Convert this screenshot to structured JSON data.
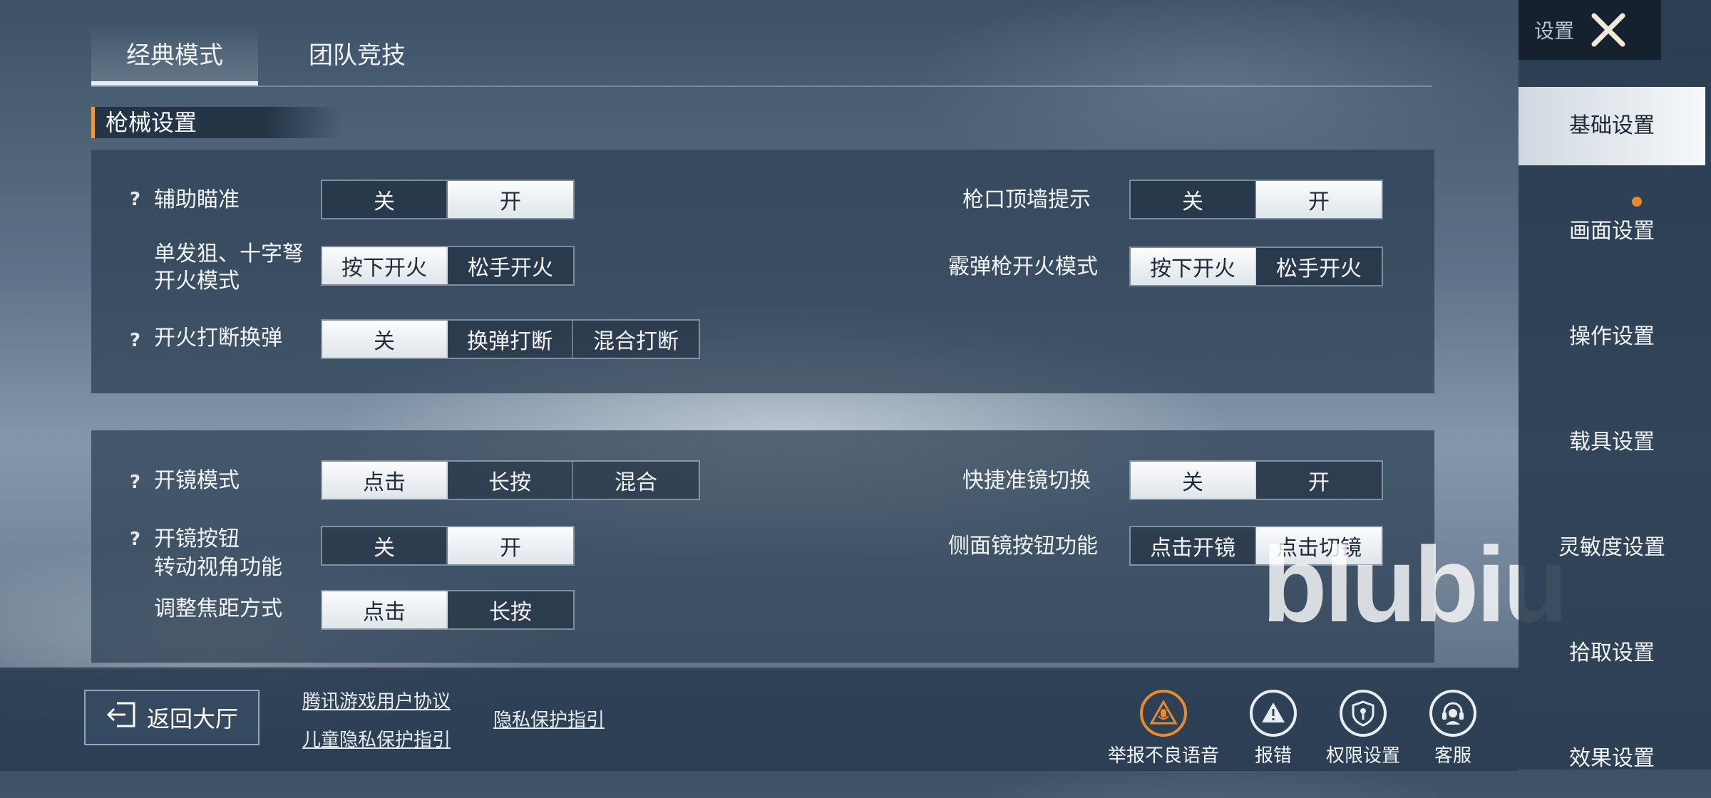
{
  "tabs": [
    {
      "label": "经典模式",
      "active": true
    },
    {
      "label": "团队竞技",
      "active": false
    }
  ],
  "section": {
    "title": "枪械设置"
  },
  "panel1": {
    "aim_assist": {
      "label": "辅助瞄准",
      "help": "?",
      "options": [
        "关",
        "开"
      ],
      "selected": "开"
    },
    "sniper_fire": {
      "label_line1": "单发狙、十字弩",
      "label_line2": "开火模式",
      "options": [
        "按下开火",
        "松手开火"
      ],
      "selected": "按下开火"
    },
    "fire_interrupt": {
      "label": "开火打断换弹",
      "help": "?",
      "options": [
        "关",
        "换弹打断",
        "混合打断"
      ],
      "selected": "关"
    },
    "muzzle_wall": {
      "label": "枪口顶墙提示",
      "options": [
        "关",
        "开"
      ],
      "selected": "开"
    },
    "shotgun_fire": {
      "label": "霰弹枪开火模式",
      "options": [
        "按下开火",
        "松手开火"
      ],
      "selected": "按下开火"
    }
  },
  "panel2": {
    "scope_mode": {
      "label": "开镜模式",
      "help": "?",
      "options": [
        "点击",
        "长按",
        "混合"
      ],
      "selected": "点击"
    },
    "scope_button": {
      "label_line1": "开镜按钮",
      "label_line2": "转动视角功能",
      "help": "?",
      "options": [
        "关",
        "开"
      ],
      "selected": "开"
    },
    "zoom_method": {
      "label": "调整焦距方式",
      "options": [
        "点击",
        "长按"
      ],
      "selected": "点击"
    },
    "quick_scope_switch": {
      "label": "快捷准镜切换",
      "options": [
        "关",
        "开"
      ],
      "selected": "关"
    },
    "side_scope": {
      "label": "侧面镜按钮功能",
      "options": [
        "点击开镜",
        "点击切镜"
      ],
      "selected": "点击切镜"
    }
  },
  "bottom": {
    "back_label": "返回大厅",
    "links": [
      "腾讯游戏用户协议",
      "儿童隐私保护指引",
      "隐私保护指引"
    ],
    "icons": [
      {
        "label": "举报不良语音",
        "icon": "report-voice-icon",
        "color": "#e88a2e"
      },
      {
        "label": "报错",
        "icon": "warning-icon",
        "color": "#e8edf2"
      },
      {
        "label": "权限设置",
        "icon": "shield-icon",
        "color": "#e8edf2"
      },
      {
        "label": "客服",
        "icon": "headset-icon",
        "color": "#e8edf2"
      }
    ]
  },
  "sidebar": {
    "title": "设置",
    "items": [
      {
        "label": "基础设置",
        "active": true
      },
      {
        "label": "画面设置",
        "active": false,
        "dot": true
      },
      {
        "label": "操作设置",
        "active": false
      },
      {
        "label": "载具设置",
        "active": false
      },
      {
        "label": "灵敏度设置",
        "active": false
      },
      {
        "label": "拾取设置",
        "active": false
      },
      {
        "label": "效果设置",
        "active": false
      }
    ]
  },
  "watermark": "blubiu",
  "colors": {
    "accent": "#e99a3c",
    "notify_dot": "#e88a2e"
  }
}
